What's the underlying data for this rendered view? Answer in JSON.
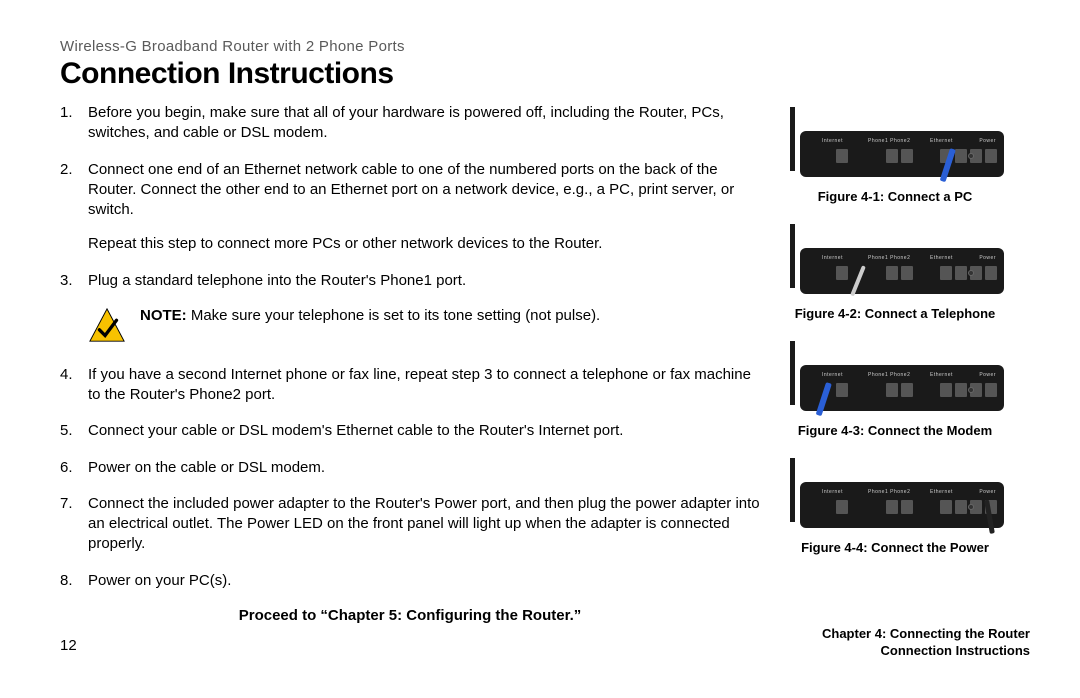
{
  "header": {
    "product_line": "Wireless-G Broadband Router with 2 Phone Ports",
    "title": "Connection Instructions"
  },
  "steps": {
    "s1": "Before you begin, make sure that all of your hardware is powered off, including the Router, PCs, switches, and cable or DSL modem.",
    "s2": "Connect one end of an Ethernet network cable to one of the numbered ports on the back of the Router. Connect the other end to an Ethernet port on a network device, e.g., a PC, print server, or switch.",
    "s2_extra": "Repeat this step to connect more PCs or other network devices to the Router.",
    "s3": "Plug a standard telephone into the Router's Phone1 port.",
    "s4": "If you have a second Internet phone or fax line, repeat step 3 to connect a telephone or fax machine to the Router's Phone2 port.",
    "s5": "Connect your cable or DSL modem's Ethernet cable to the Router's Internet port.",
    "s6": "Power on the cable or DSL modem.",
    "s7": "Connect the included power adapter to the Router's Power port, and then plug the power adapter into an electrical outlet. The Power LED on the front panel will light up when the adapter is connected properly.",
    "s8": "Power on your PC(s)."
  },
  "note": {
    "label": "NOTE:",
    "text": "  Make sure your telephone is set to its tone setting (not pulse)."
  },
  "proceed": "Proceed to “Chapter 5: Configuring the Router.”",
  "figures": {
    "f1": "Figure 4-1: Connect a PC",
    "f2": "Figure 4-2: Connect a Telephone",
    "f3": "Figure 4-3: Connect the Modem",
    "f4": "Figure 4-4: Connect the Power"
  },
  "router_labels": {
    "internet": "Internet",
    "phone": "Phone1 Phone2",
    "ethernet": "Ethernet",
    "power": "Power"
  },
  "footer": {
    "page": "12",
    "chapter": "Chapter 4: Connecting the Router",
    "section": "Connection Instructions"
  }
}
